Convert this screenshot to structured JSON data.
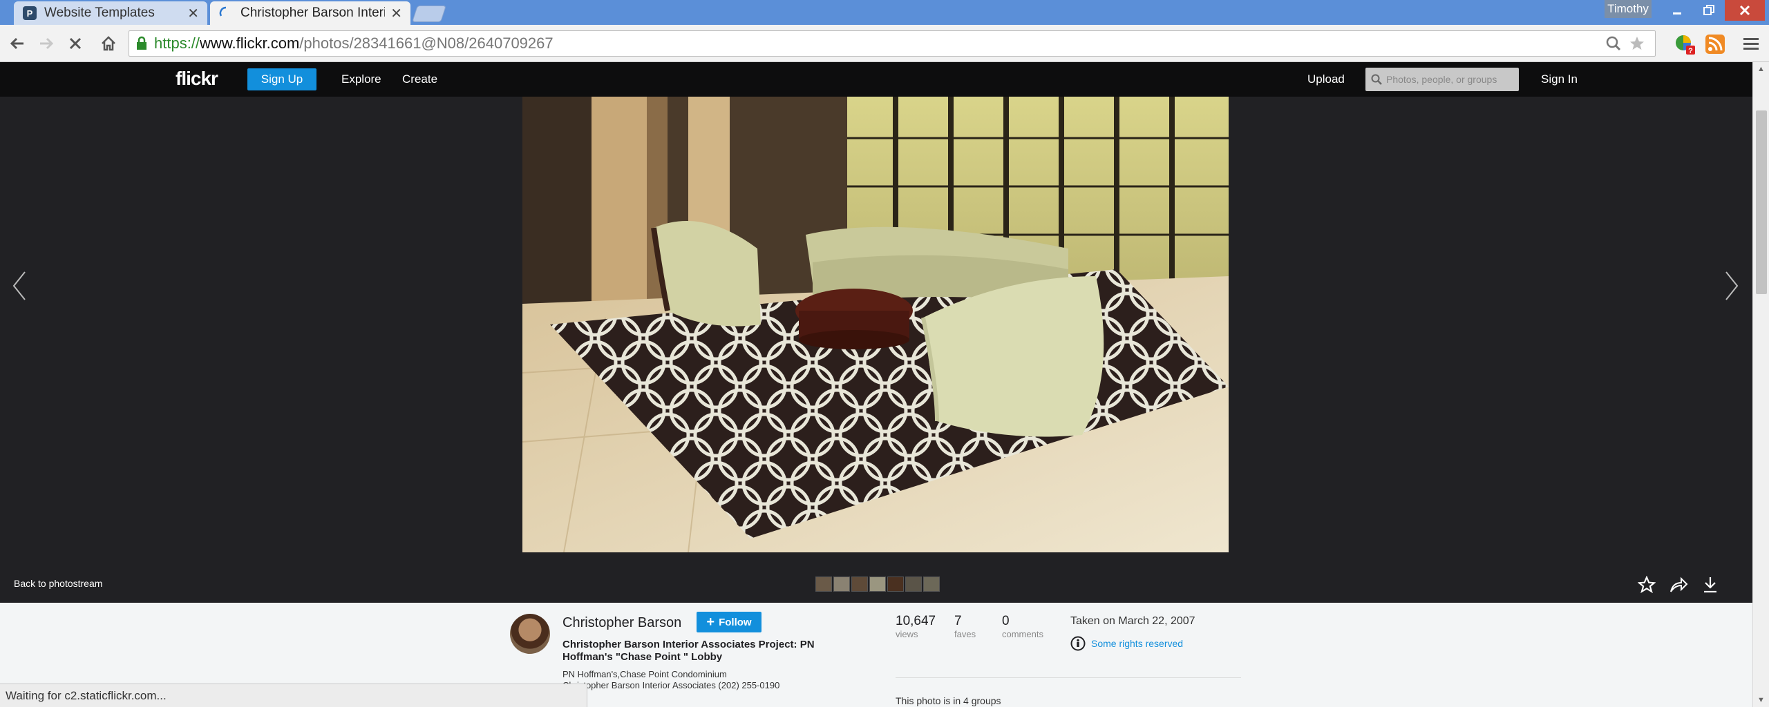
{
  "browser": {
    "tabs": [
      {
        "title": "Website Templates",
        "active": false
      },
      {
        "title": "Christopher Barson Interio",
        "active": true
      }
    ],
    "user": "Timothy",
    "url": {
      "scheme": "https://",
      "domain": "www.flickr.com",
      "path": "/photos/28341661@N08/2640709267"
    },
    "status": "Waiting for c2.staticflickr.com...",
    "accent": "#5b8fd8"
  },
  "flickr": {
    "header": {
      "logo": "flickr",
      "signup": "Sign Up",
      "explore": "Explore",
      "create": "Create",
      "upload": "Upload",
      "search_placeholder": "Photos, people, or groups",
      "signin": "Sign In"
    },
    "viewer": {
      "back": "Back to photostream",
      "prev_icon": "chevron-left-icon",
      "next_icon": "chevron-right-icon"
    },
    "info": {
      "owner": "Christopher Barson",
      "follow": "Follow",
      "title": "Christopher Barson Interior Associates Project: PN Hoffman's \"Chase Point \" Lobby",
      "desc_line1": "PN Hoffman's,Chase Point Condominium",
      "desc_line2": "Christopher Barson Interior Associates (202) 255-0190",
      "stats": {
        "views": {
          "num": "10,647",
          "label": "views"
        },
        "faves": {
          "num": "7",
          "label": "faves"
        },
        "comments": {
          "num": "0",
          "label": "comments"
        }
      },
      "taken": "Taken on March 22, 2007",
      "rights": "Some rights reserved",
      "groups": "This photo is in 4 groups"
    },
    "colors": {
      "blue": "#128fdc",
      "dark": "#212124"
    }
  }
}
